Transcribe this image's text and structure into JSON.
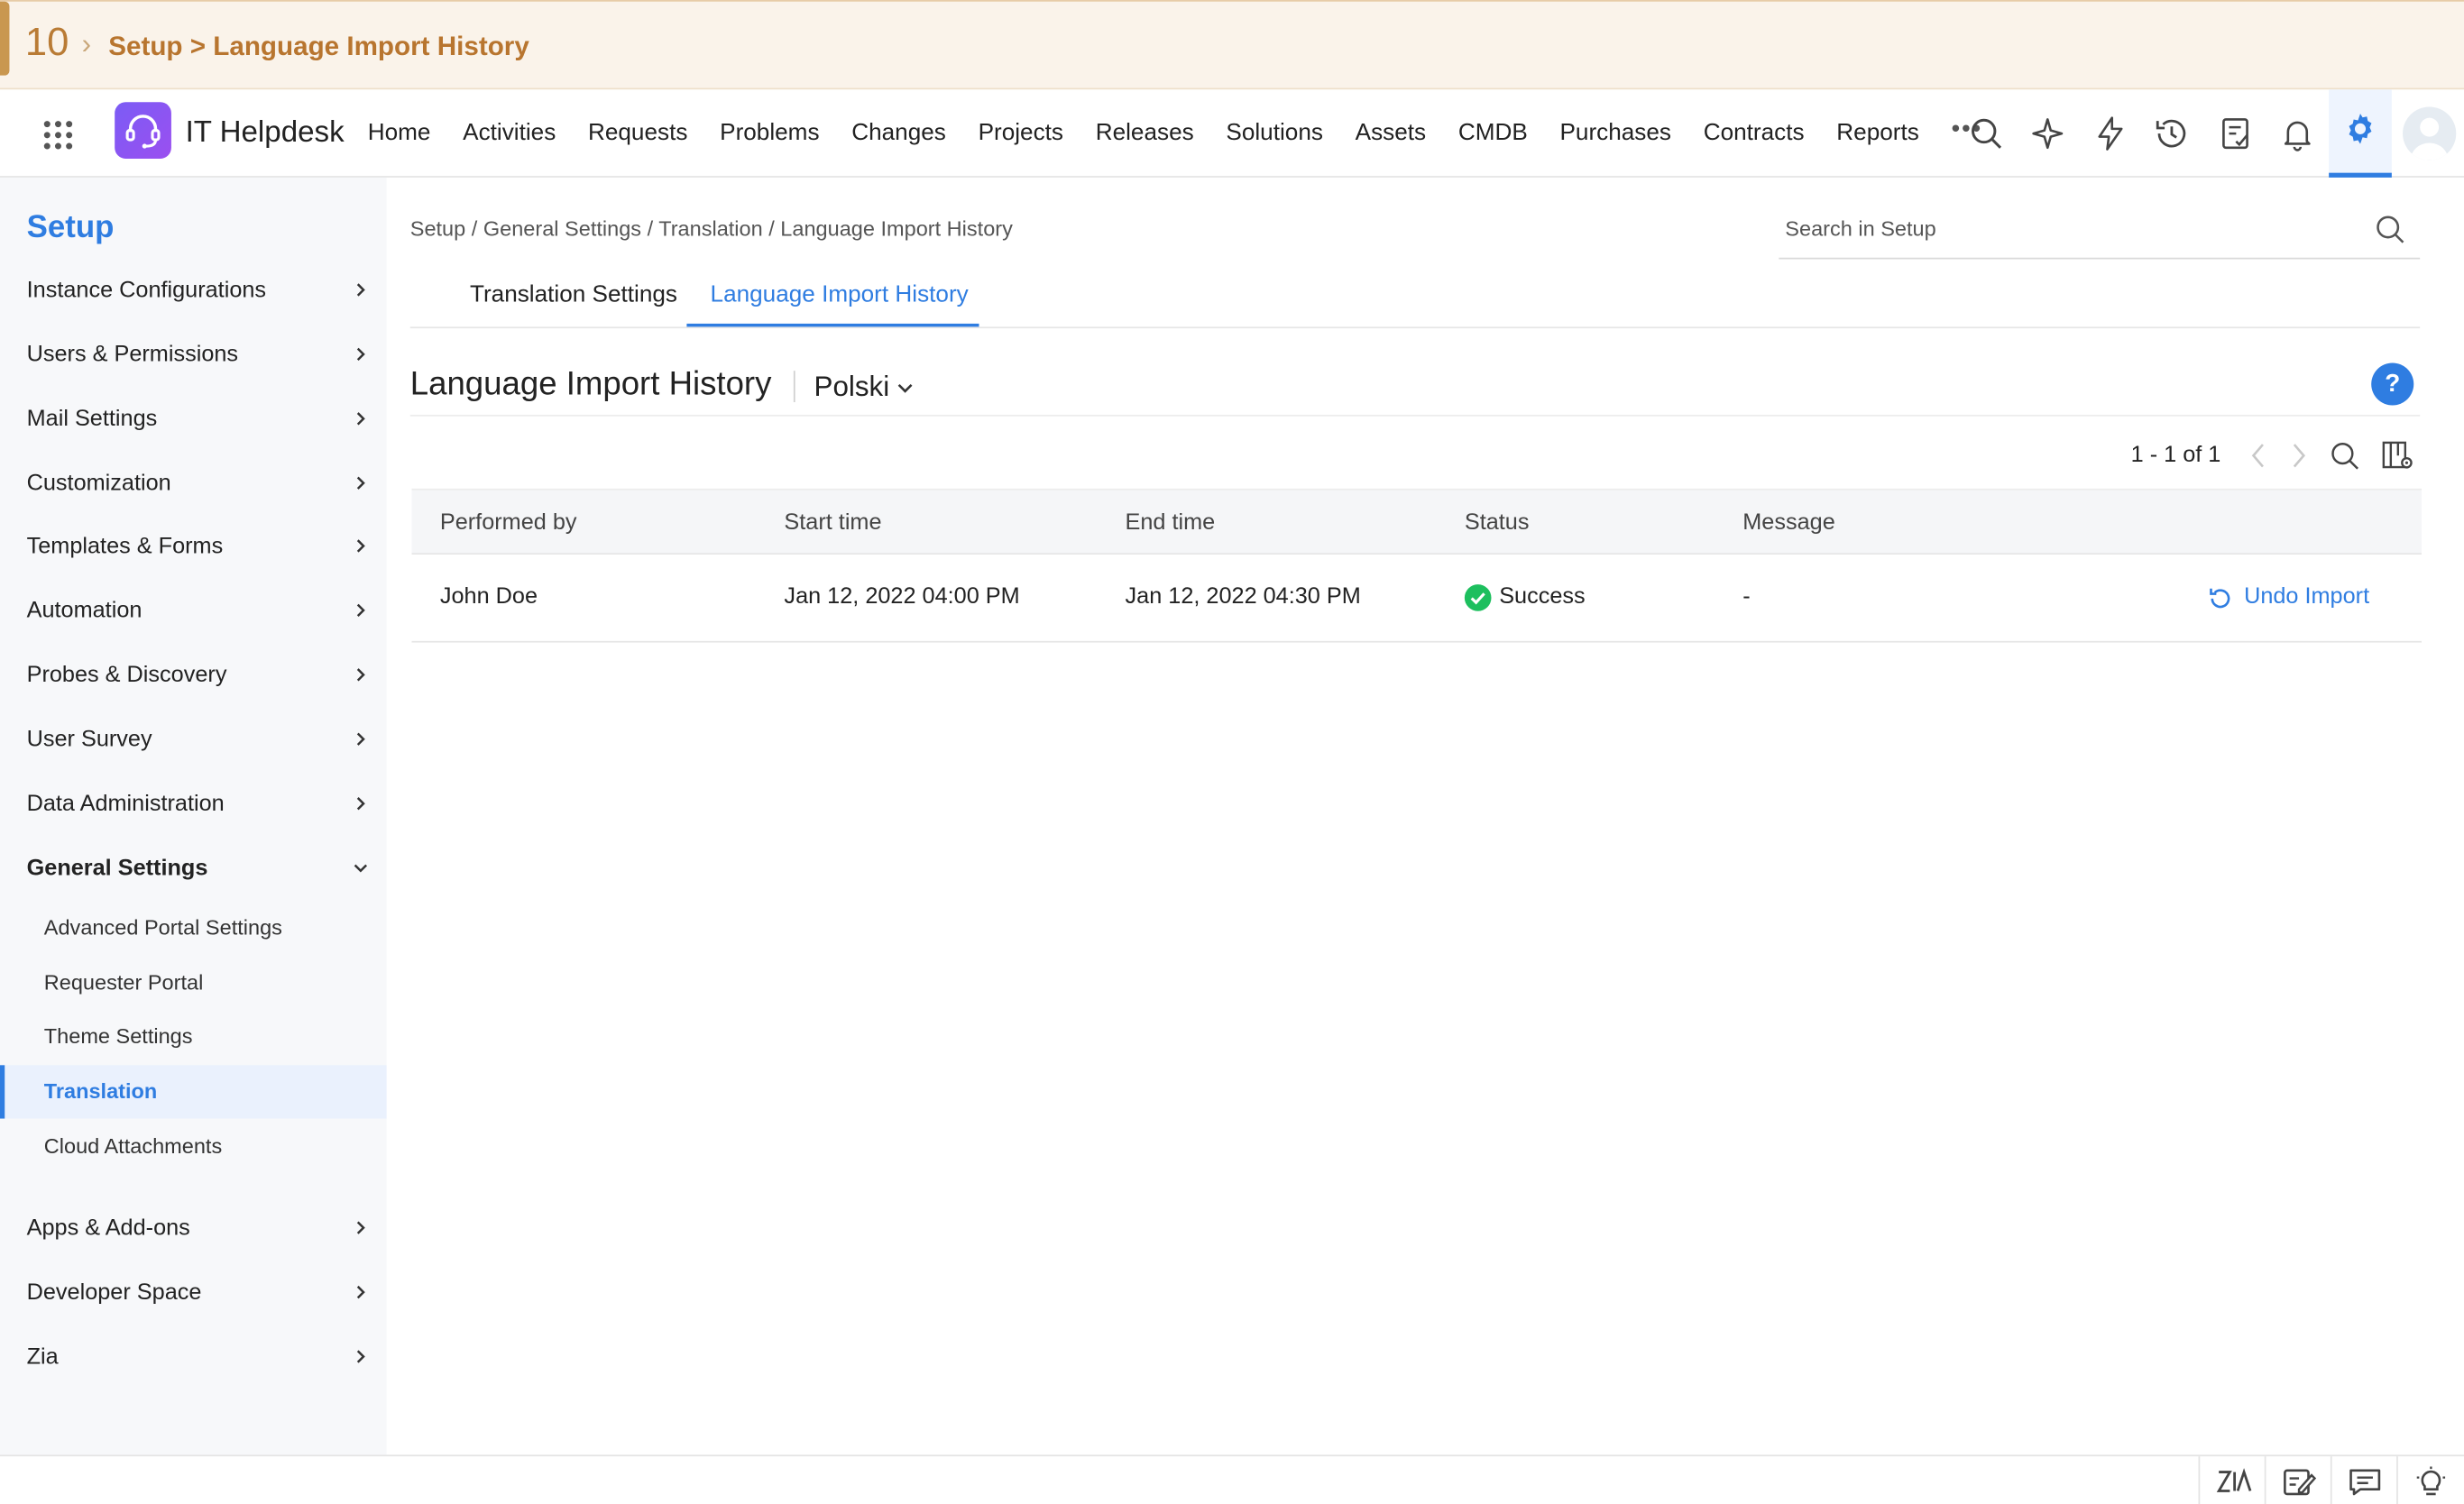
{
  "banner": {
    "number": "10",
    "crumb": "Setup > Language Import History"
  },
  "header": {
    "brand": "IT Helpdesk",
    "nav": [
      "Home",
      "Activities",
      "Requests",
      "Problems",
      "Changes",
      "Projects",
      "Releases",
      "Solutions",
      "Assets",
      "CMDB",
      "Purchases",
      "Contracts",
      "Reports"
    ],
    "more": "•••"
  },
  "sidebar": {
    "title": "Setup",
    "items": [
      {
        "label": "Instance Configurations"
      },
      {
        "label": "Users & Permissions"
      },
      {
        "label": "Mail Settings"
      },
      {
        "label": "Customization"
      },
      {
        "label": "Templates & Forms"
      },
      {
        "label": "Automation"
      },
      {
        "label": "Probes & Discovery"
      },
      {
        "label": "User Survey"
      },
      {
        "label": "Data Administration"
      },
      {
        "label": "General Settings"
      }
    ],
    "sub_items": [
      {
        "label": "Advanced Portal Settings"
      },
      {
        "label": "Requester Portal"
      },
      {
        "label": "Theme Settings"
      },
      {
        "label": "Translation"
      },
      {
        "label": "Cloud Attachments"
      }
    ],
    "bottom_items": [
      {
        "label": "Apps & Add-ons"
      },
      {
        "label": "Developer Space"
      },
      {
        "label": "Zia"
      }
    ]
  },
  "main": {
    "breadcrumb": "Setup / General Settings / Translation / Language Import History",
    "search_placeholder": "Search in Setup",
    "tabs": [
      {
        "label": "Translation Settings"
      },
      {
        "label": "Language Import History"
      }
    ],
    "title": "Language Import History",
    "language": "Polski",
    "help": "?",
    "pager": "1 - 1 of 1",
    "table": {
      "columns": [
        "Performed by",
        "Start time",
        "End time",
        "Status",
        "Message"
      ],
      "rows": [
        {
          "performed_by": "John Doe",
          "start": "Jan 12, 2022 04:00 PM",
          "end": "Jan 12, 2022 04:30 PM",
          "status": "Success",
          "message": "-",
          "action": "Undo Import"
        }
      ]
    }
  },
  "colors": {
    "accent": "#2f7de1",
    "success": "#1dbf5e",
    "banner_text": "#b8752f"
  }
}
